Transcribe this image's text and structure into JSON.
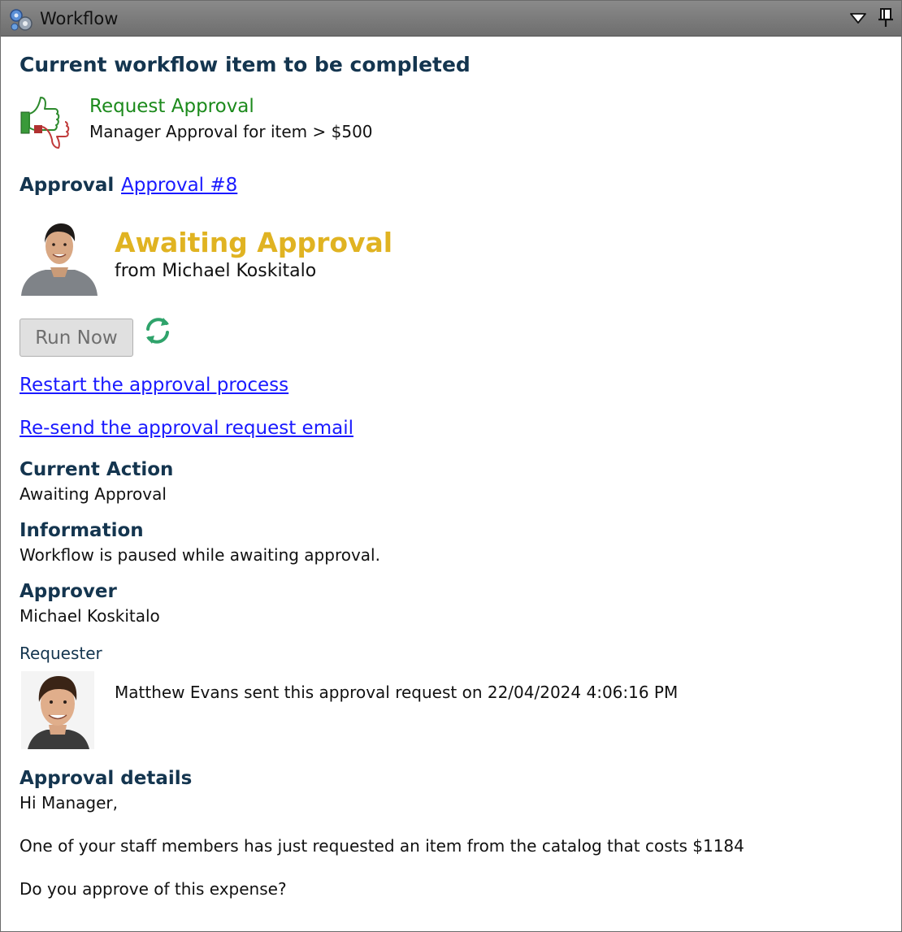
{
  "window": {
    "title": "Workflow",
    "icons": {
      "app": "gears-icon",
      "dropdown": "triangle-down-icon",
      "pin": "pin-icon"
    }
  },
  "main": {
    "heading": "Current workflow item to be completed",
    "step": {
      "icon": "thumbs-up-down-icon",
      "title": "Request Approval",
      "description": "Manager Approval for item > $500"
    },
    "approval": {
      "label": "Approval",
      "link": "Approval #8"
    },
    "status": {
      "title": "Awaiting Approval",
      "from": "from Michael Koskitalo",
      "color": "#e0b322"
    },
    "actions": {
      "run_now": "Run Now",
      "refresh_icon": "refresh-icon",
      "restart_link": "Restart the approval process",
      "resend_link": "Re-send the approval request email"
    },
    "fields": {
      "current_action_label": "Current Action",
      "current_action_value": "Awaiting Approval",
      "information_label": "Information",
      "information_value": "Workflow is paused while awaiting approval.",
      "approver_label": "Approver",
      "approver_value": "Michael Koskitalo",
      "requester_label": "Requester",
      "requester_text": "Matthew Evans sent this approval request on 22/04/2024 4:06:16 PM"
    },
    "details": {
      "label": "Approval details",
      "line1": "Hi Manager,",
      "line2": "One of your staff members has just requested an item from the catalog that costs $1184",
      "line3": "Do you approve of this expense?"
    }
  },
  "colors": {
    "heading": "#14354f",
    "link": "#1a1aff",
    "step_title": "#1c8a1c",
    "titlebar": "#7a7a7a"
  }
}
